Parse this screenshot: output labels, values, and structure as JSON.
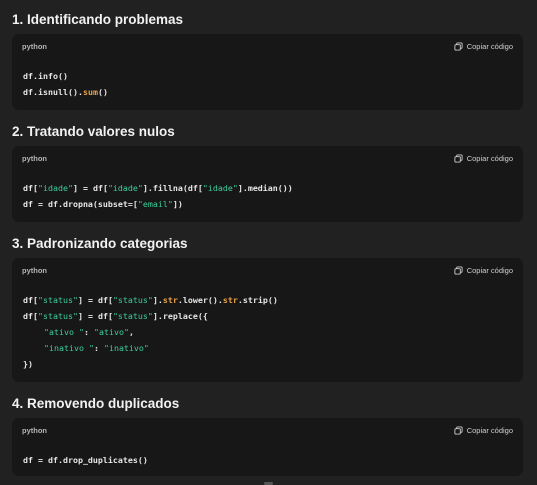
{
  "copy_label": "Copiar código",
  "copy_icon": "copy-icon",
  "sections": [
    {
      "title": "1. Identificando problemas",
      "lang": "python",
      "lines": [
        [
          {
            "t": "df.info()",
            "c": "p"
          }
        ],
        [
          {
            "t": "df.isnull().",
            "c": "p"
          },
          {
            "t": "sum",
            "c": "fn"
          },
          {
            "t": "()",
            "c": "p"
          }
        ]
      ]
    },
    {
      "title": "2. Tratando valores nulos",
      "lang": "python",
      "lines": [
        [
          {
            "t": "df[",
            "c": "p"
          },
          {
            "t": "\"idade\"",
            "c": "str"
          },
          {
            "t": "] = df[",
            "c": "p"
          },
          {
            "t": "\"idade\"",
            "c": "str"
          },
          {
            "t": "].fillna(df[",
            "c": "p"
          },
          {
            "t": "\"idade\"",
            "c": "str"
          },
          {
            "t": "].median())",
            "c": "p"
          }
        ],
        [
          {
            "t": "df = df.dropna(subset=[",
            "c": "p"
          },
          {
            "t": "\"email\"",
            "c": "str"
          },
          {
            "t": "])",
            "c": "p"
          }
        ]
      ]
    },
    {
      "title": "3. Padronizando categorias",
      "lang": "python",
      "lines": [
        [
          {
            "t": "df[",
            "c": "p"
          },
          {
            "t": "\"status\"",
            "c": "str"
          },
          {
            "t": "] = df[",
            "c": "p"
          },
          {
            "t": "\"status\"",
            "c": "str"
          },
          {
            "t": "].",
            "c": "p"
          },
          {
            "t": "str",
            "c": "fn"
          },
          {
            "t": ".lower().",
            "c": "p"
          },
          {
            "t": "str",
            "c": "fn"
          },
          {
            "t": ".strip()",
            "c": "p"
          }
        ],
        [
          {
            "t": "df[",
            "c": "p"
          },
          {
            "t": "\"status\"",
            "c": "str"
          },
          {
            "t": "] = df[",
            "c": "p"
          },
          {
            "t": "\"status\"",
            "c": "str"
          },
          {
            "t": "].replace({",
            "c": "p"
          }
        ],
        [
          {
            "t": "\"ativo \"",
            "c": "str"
          },
          {
            "t": ": ",
            "c": "p"
          },
          {
            "t": "\"ativo\"",
            "c": "str"
          },
          {
            "t": ",",
            "c": "p"
          }
        ],
        [
          {
            "t": "\"inativo \"",
            "c": "str"
          },
          {
            "t": ": ",
            "c": "p"
          },
          {
            "t": "\"inativo\"",
            "c": "str"
          }
        ],
        [
          {
            "t": "})",
            "c": "p"
          }
        ]
      ]
    },
    {
      "title": "4. Removendo duplicados",
      "lang": "python",
      "lines": [
        [
          {
            "t": "df = df.drop_duplicates()",
            "c": "p"
          }
        ]
      ]
    }
  ]
}
